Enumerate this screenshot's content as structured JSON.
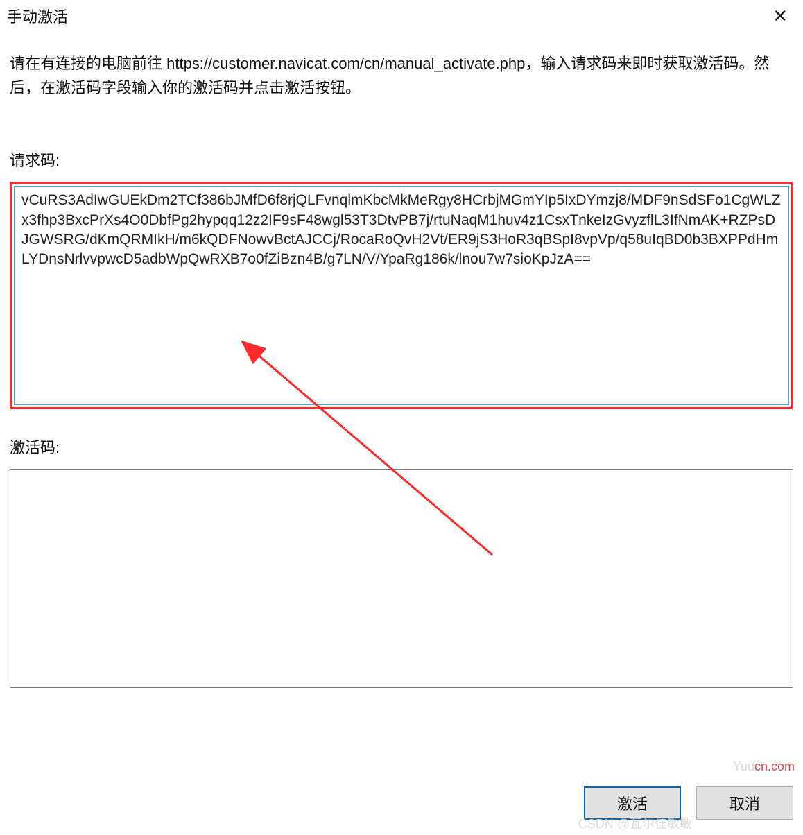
{
  "window": {
    "title": "手动激活",
    "close_label": "✕"
  },
  "instructions": "请在有连接的电脑前往 https://customer.navicat.com/cn/manual_activate.php，输入请求码来即时获取激活码。然后，在激活码字段输入你的激活码并点击激活按钮。",
  "request": {
    "label": "请求码:",
    "value": "vCuRS3AdIwGUEkDm2TCf386bJMfD6f8rjQLFvnqlmKbcMkMeRgy8HCrbjMGmYIp5IxDYmzj8/MDF9nSdSFo1CgWLZx3fhp3BxcPrXs4O0DbfPg2hypqq12z2IF9sF48wgl53T3DtvPB7j/rtuNaqM1huv4z1CsxTnkeIzGvyzflL3IfNmAK+RZPsDJGWSRG/dKmQRMIkH/m6kQDFNowvBctAJCCj/RocaRoQvH2Vt/ER9jS3HoR3qBSpI8vpVp/q58uIqBD0b3BXPPdHmLYDnsNrlvvpwcD5adbWpQwRXB7o0fZiBzn4B/g7LN/V/YpaRg186k/lnou7w7sioKpJzA=="
  },
  "activation": {
    "label": "激活码:",
    "value": ""
  },
  "buttons": {
    "activate": "激活",
    "cancel": "取消"
  },
  "watermarks": {
    "site_plain": "Yuu",
    "site_red": "cn.com",
    "csdn": "CSDN @瓦尔佳敏敏"
  }
}
